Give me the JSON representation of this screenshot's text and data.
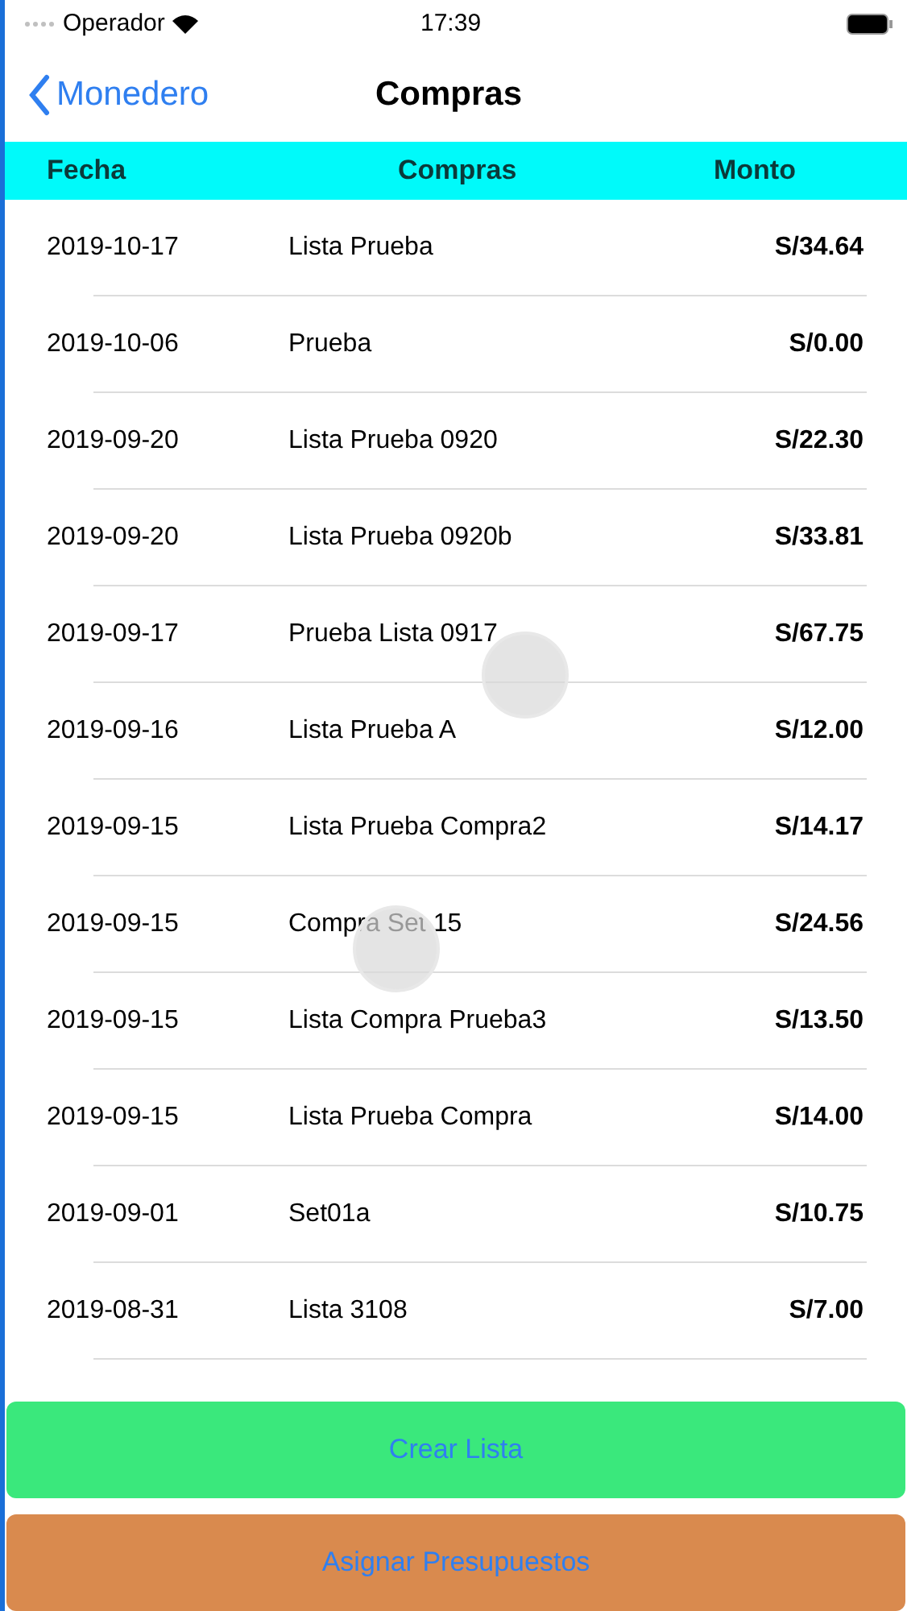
{
  "status_bar": {
    "carrier": "Operador",
    "time": "17:39"
  },
  "nav": {
    "back": "Monedero",
    "title": "Compras"
  },
  "table": {
    "columns": [
      "Fecha",
      "Compras",
      "Monto"
    ],
    "rows": [
      {
        "date": "2019-10-17",
        "name": "Lista Prueba",
        "amount": "S/34.64"
      },
      {
        "date": "2019-10-06",
        "name": "Prueba",
        "amount": "S/0.00"
      },
      {
        "date": "2019-09-20",
        "name": "Lista Prueba 0920",
        "amount": "S/22.30"
      },
      {
        "date": "2019-09-20",
        "name": "Lista Prueba 0920b",
        "amount": "S/33.81"
      },
      {
        "date": "2019-09-17",
        "name": "Prueba Lista 0917",
        "amount": "S/67.75"
      },
      {
        "date": "2019-09-16",
        "name": "Lista Prueba A",
        "amount": "S/12.00"
      },
      {
        "date": "2019-09-15",
        "name": "Lista Prueba Compra2",
        "amount": "S/14.17"
      },
      {
        "date": "2019-09-15",
        "name": "Compra Set 15",
        "amount": "S/24.56"
      },
      {
        "date": "2019-09-15",
        "name": "Lista Compra Prueba3",
        "amount": "S/13.50"
      },
      {
        "date": "2019-09-15",
        "name": "Lista Prueba Compra",
        "amount": "S/14.00"
      },
      {
        "date": "2019-09-01",
        "name": "Set01a",
        "amount": "S/10.75"
      },
      {
        "date": "2019-08-31",
        "name": "Lista 3108",
        "amount": "S/7.00"
      }
    ]
  },
  "buttons": [
    {
      "label": "Crear Lista",
      "kind": "create"
    },
    {
      "label": "Asignar Presupuestos",
      "kind": "assign"
    }
  ]
}
